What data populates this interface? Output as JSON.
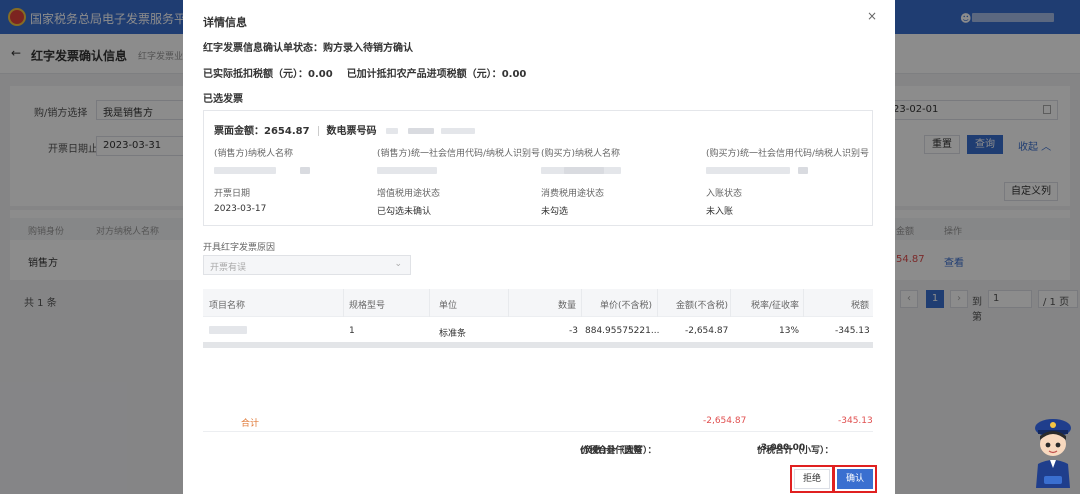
{
  "app": {
    "title": "国家税务总局电子发票服务平台"
  },
  "page": {
    "title": "红字发票确认信息",
    "breadcrumb": "红字发票业"
  },
  "filters": {
    "role_label": "购/销方选择",
    "role_value": "我是销售方",
    "date_label": "开票日期止",
    "date_value": "2023-03-31",
    "date_from_value": "23-02-01",
    "reset_label": "重置",
    "search_label": "查询",
    "collapse_label": "收起 ︿",
    "custom_columns_label": "自定义列"
  },
  "list": {
    "headers": [
      "购销身份",
      "对方纳税人名称",
      "金额",
      "操作"
    ],
    "row": {
      "role": "销售方",
      "amount": "54.87",
      "action": "查看"
    },
    "total": "共 1 条",
    "pager": {
      "current": "1",
      "goto_label": "到第",
      "goto_value": "1",
      "total_pages": "/ 1 页"
    }
  },
  "modal": {
    "title": "详情信息",
    "close": "×",
    "status_label": "红字发票信息确认单状态：",
    "status_value": "购方录入待销方确认",
    "tax_deducted_label": "已实际抵扣税额（元）：",
    "tax_deducted_value": "0.00",
    "farm_tax_label": "已加计抵扣农产品进项税额（元）：",
    "farm_tax_value": "0.00",
    "selected_invoice_title": "已选发票",
    "card": {
      "amount_label": "票面金额：",
      "amount_value": "2654.87",
      "digital_no_label": "数电票号码",
      "seller_name_label": "(销售方)纳税人名称",
      "seller_id_label": "(销售方)统一社会信用代码/纳税人识别号",
      "buyer_name_label": "(购买方)纳税人名称",
      "buyer_id_label": "(购买方)统一社会信用代码/纳税人识别号",
      "issue_date_label": "开票日期",
      "issue_date_value": "2023-03-17",
      "vat_status_label": "增值税用途状态",
      "vat_status_value": "已勾选未确认",
      "consumption_status_label": "消费税用途状态",
      "consumption_status_value": "未勾选",
      "account_status_label": "入账状态",
      "account_status_value": "未入账"
    },
    "reason_label": "开具红字发票原因",
    "reason_placeholder": "开票有误",
    "detail_headers": [
      "项目名称",
      "规格型号",
      "单位",
      "数量",
      "单价(不含税)",
      "金额(不含税)",
      "税率/征收率",
      "税额"
    ],
    "detail_row": {
      "spec": "1",
      "unit": "标准条",
      "qty": "-3",
      "unit_price": "884.95575221...",
      "amount": "-2,654.87",
      "rate": "13%",
      "tax": "-345.13"
    },
    "sum_label": "合计",
    "sum_amount": "-2,654.87",
    "sum_tax": "-345.13",
    "total_caps_label": "价税合计（大写）：",
    "total_caps_value": "(负数)叁仟圆整",
    "total_num_label": "价税合计（小写）：",
    "total_num_value": "-3,000.00",
    "reject_label": "拒绝",
    "confirm_label": "确认"
  },
  "colors": {
    "primary": "#3a6fd0",
    "negative": "#e04f4f",
    "highlight": "#e02020"
  }
}
